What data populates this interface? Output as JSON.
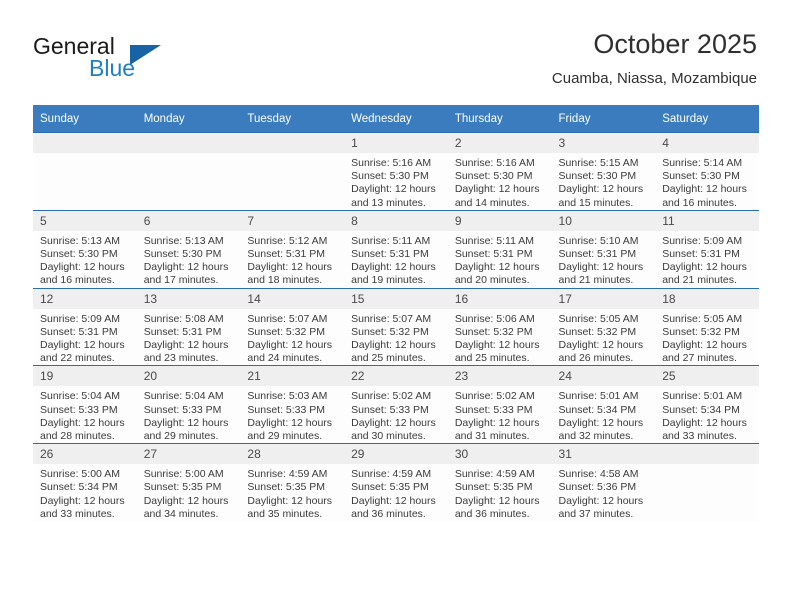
{
  "brand": {
    "name_part1": "General",
    "name_part2": "Blue",
    "logo_icon": "triangle-icon"
  },
  "header": {
    "title": "October 2025",
    "subtitle": "Cuamba, Niassa, Mozambique"
  },
  "weekday_headers": [
    "Sunday",
    "Monday",
    "Tuesday",
    "Wednesday",
    "Thursday",
    "Friday",
    "Saturday"
  ],
  "colors": {
    "header_blue": "#3a7cbe",
    "row_border_blue": "#2a6db5",
    "daynum_band": "#efefef",
    "logo_blue": "#1f7fc4",
    "logo_triangle": "#1763a5"
  },
  "weeks": [
    [
      {
        "day": "",
        "lines": []
      },
      {
        "day": "",
        "lines": []
      },
      {
        "day": "",
        "lines": []
      },
      {
        "day": "1",
        "lines": [
          "Sunrise: 5:16 AM",
          "Sunset: 5:30 PM",
          "Daylight: 12 hours",
          "and 13 minutes."
        ]
      },
      {
        "day": "2",
        "lines": [
          "Sunrise: 5:16 AM",
          "Sunset: 5:30 PM",
          "Daylight: 12 hours",
          "and 14 minutes."
        ]
      },
      {
        "day": "3",
        "lines": [
          "Sunrise: 5:15 AM",
          "Sunset: 5:30 PM",
          "Daylight: 12 hours",
          "and 15 minutes."
        ]
      },
      {
        "day": "4",
        "lines": [
          "Sunrise: 5:14 AM",
          "Sunset: 5:30 PM",
          "Daylight: 12 hours",
          "and 16 minutes."
        ]
      }
    ],
    [
      {
        "day": "5",
        "lines": [
          "Sunrise: 5:13 AM",
          "Sunset: 5:30 PM",
          "Daylight: 12 hours",
          "and 16 minutes."
        ]
      },
      {
        "day": "6",
        "lines": [
          "Sunrise: 5:13 AM",
          "Sunset: 5:30 PM",
          "Daylight: 12 hours",
          "and 17 minutes."
        ]
      },
      {
        "day": "7",
        "lines": [
          "Sunrise: 5:12 AM",
          "Sunset: 5:31 PM",
          "Daylight: 12 hours",
          "and 18 minutes."
        ]
      },
      {
        "day": "8",
        "lines": [
          "Sunrise: 5:11 AM",
          "Sunset: 5:31 PM",
          "Daylight: 12 hours",
          "and 19 minutes."
        ]
      },
      {
        "day": "9",
        "lines": [
          "Sunrise: 5:11 AM",
          "Sunset: 5:31 PM",
          "Daylight: 12 hours",
          "and 20 minutes."
        ]
      },
      {
        "day": "10",
        "lines": [
          "Sunrise: 5:10 AM",
          "Sunset: 5:31 PM",
          "Daylight: 12 hours",
          "and 21 minutes."
        ]
      },
      {
        "day": "11",
        "lines": [
          "Sunrise: 5:09 AM",
          "Sunset: 5:31 PM",
          "Daylight: 12 hours",
          "and 21 minutes."
        ]
      }
    ],
    [
      {
        "day": "12",
        "lines": [
          "Sunrise: 5:09 AM",
          "Sunset: 5:31 PM",
          "Daylight: 12 hours",
          "and 22 minutes."
        ]
      },
      {
        "day": "13",
        "lines": [
          "Sunrise: 5:08 AM",
          "Sunset: 5:31 PM",
          "Daylight: 12 hours",
          "and 23 minutes."
        ]
      },
      {
        "day": "14",
        "lines": [
          "Sunrise: 5:07 AM",
          "Sunset: 5:32 PM",
          "Daylight: 12 hours",
          "and 24 minutes."
        ]
      },
      {
        "day": "15",
        "lines": [
          "Sunrise: 5:07 AM",
          "Sunset: 5:32 PM",
          "Daylight: 12 hours",
          "and 25 minutes."
        ]
      },
      {
        "day": "16",
        "lines": [
          "Sunrise: 5:06 AM",
          "Sunset: 5:32 PM",
          "Daylight: 12 hours",
          "and 25 minutes."
        ]
      },
      {
        "day": "17",
        "lines": [
          "Sunrise: 5:05 AM",
          "Sunset: 5:32 PM",
          "Daylight: 12 hours",
          "and 26 minutes."
        ]
      },
      {
        "day": "18",
        "lines": [
          "Sunrise: 5:05 AM",
          "Sunset: 5:32 PM",
          "Daylight: 12 hours",
          "and 27 minutes."
        ]
      }
    ],
    [
      {
        "day": "19",
        "lines": [
          "Sunrise: 5:04 AM",
          "Sunset: 5:33 PM",
          "Daylight: 12 hours",
          "and 28 minutes."
        ]
      },
      {
        "day": "20",
        "lines": [
          "Sunrise: 5:04 AM",
          "Sunset: 5:33 PM",
          "Daylight: 12 hours",
          "and 29 minutes."
        ]
      },
      {
        "day": "21",
        "lines": [
          "Sunrise: 5:03 AM",
          "Sunset: 5:33 PM",
          "Daylight: 12 hours",
          "and 29 minutes."
        ]
      },
      {
        "day": "22",
        "lines": [
          "Sunrise: 5:02 AM",
          "Sunset: 5:33 PM",
          "Daylight: 12 hours",
          "and 30 minutes."
        ]
      },
      {
        "day": "23",
        "lines": [
          "Sunrise: 5:02 AM",
          "Sunset: 5:33 PM",
          "Daylight: 12 hours",
          "and 31 minutes."
        ]
      },
      {
        "day": "24",
        "lines": [
          "Sunrise: 5:01 AM",
          "Sunset: 5:34 PM",
          "Daylight: 12 hours",
          "and 32 minutes."
        ]
      },
      {
        "day": "25",
        "lines": [
          "Sunrise: 5:01 AM",
          "Sunset: 5:34 PM",
          "Daylight: 12 hours",
          "and 33 minutes."
        ]
      }
    ],
    [
      {
        "day": "26",
        "lines": [
          "Sunrise: 5:00 AM",
          "Sunset: 5:34 PM",
          "Daylight: 12 hours",
          "and 33 minutes."
        ]
      },
      {
        "day": "27",
        "lines": [
          "Sunrise: 5:00 AM",
          "Sunset: 5:35 PM",
          "Daylight: 12 hours",
          "and 34 minutes."
        ]
      },
      {
        "day": "28",
        "lines": [
          "Sunrise: 4:59 AM",
          "Sunset: 5:35 PM",
          "Daylight: 12 hours",
          "and 35 minutes."
        ]
      },
      {
        "day": "29",
        "lines": [
          "Sunrise: 4:59 AM",
          "Sunset: 5:35 PM",
          "Daylight: 12 hours",
          "and 36 minutes."
        ]
      },
      {
        "day": "30",
        "lines": [
          "Sunrise: 4:59 AM",
          "Sunset: 5:35 PM",
          "Daylight: 12 hours",
          "and 36 minutes."
        ]
      },
      {
        "day": "31",
        "lines": [
          "Sunrise: 4:58 AM",
          "Sunset: 5:36 PM",
          "Daylight: 12 hours",
          "and 37 minutes."
        ]
      },
      {
        "day": "",
        "lines": []
      }
    ]
  ]
}
